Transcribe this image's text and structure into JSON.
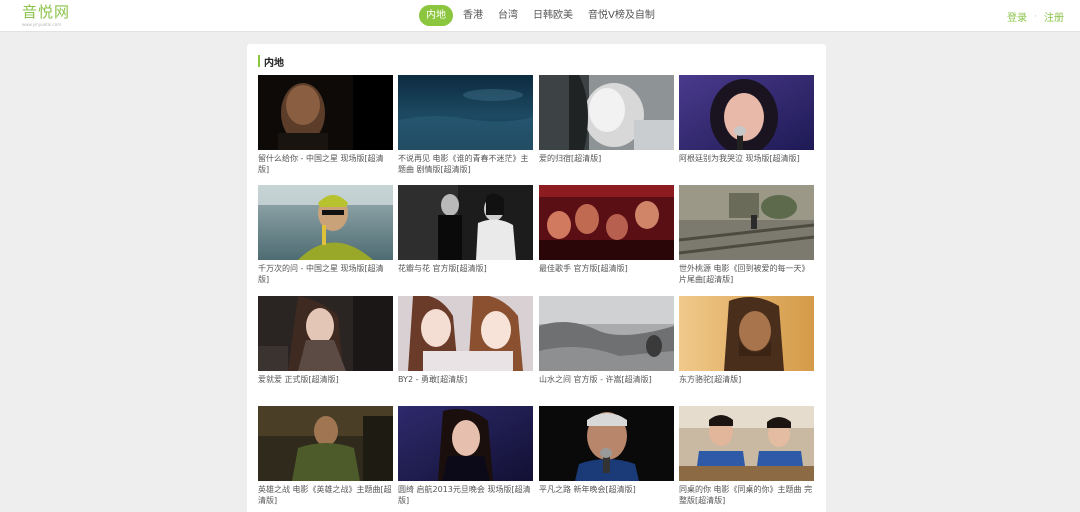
{
  "site": {
    "logo": "音悦网",
    "logo_sub": "www.yinyuetai.com"
  },
  "nav": [
    {
      "label": "内地",
      "active": true
    },
    {
      "label": "香港",
      "active": false
    },
    {
      "label": "台湾",
      "active": false
    },
    {
      "label": "日韩欧美",
      "active": false
    },
    {
      "label": "音悦V榜及自制",
      "active": false
    }
  ],
  "auth": {
    "login": "登录",
    "separator": "·",
    "register": "注册"
  },
  "section": {
    "title": "内地",
    "accent": "#8cc63f"
  },
  "videos": [
    {
      "title": "留什么给你 - 中国之星 现场版[超清版]",
      "thumb": "dark-portrait"
    },
    {
      "title": "不说再见 电影《谁的青春不迷茫》主题曲 剧情版[超清版]",
      "thumb": "ocean-night"
    },
    {
      "title": "爱的归宿[超清版]",
      "thumb": "pale-portrait"
    },
    {
      "title": "阿根廷别为我哭泣 现场版[超清版]",
      "thumb": "stage-singer"
    },
    {
      "title": "千万次的问 - 中国之星 现场版[超清版]",
      "thumb": "yellow-singer"
    },
    {
      "title": "花瓣与花 官方版[超清版]",
      "thumb": "couple-bw"
    },
    {
      "title": "最佳歌手 官方版[超清版]",
      "thumb": "red-crowd"
    },
    {
      "title": "世外桃源 电影《回到被爱的每一天》片尾曲[超清版]",
      "thumb": "rail-tracks"
    },
    {
      "title": "爱就爱 正式版[超清版]",
      "thumb": "woman-dark"
    },
    {
      "title": "BY2 - 勇敢[超清版]",
      "thumb": "two-girls"
    },
    {
      "title": "山水之间 官方版 - 许嵩[超清版]",
      "thumb": "rocky-shore"
    },
    {
      "title": "东方骆驼[超清版]",
      "thumb": "bearded-man"
    },
    {
      "title": "英雄之战 电影《英雄之战》主题曲[超清版]",
      "thumb": "green-fighter"
    },
    {
      "title": "圆绮 启航2013元旦晚会 现场版[超清版]",
      "thumb": "blue-singer"
    },
    {
      "title": "平凡之路 新年晚会[超清版]",
      "thumb": "male-mic"
    },
    {
      "title": "同桌的你 电影《同桌的你》主题曲 完整版[超清版]",
      "thumb": "classroom"
    }
  ]
}
